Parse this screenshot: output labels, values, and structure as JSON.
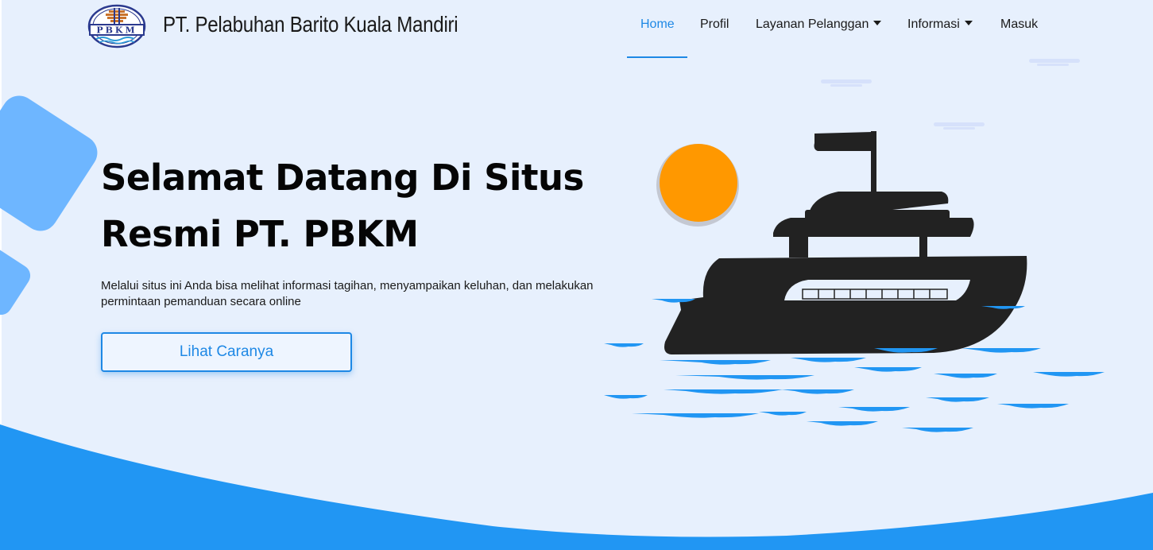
{
  "brand": {
    "name": "PT. Pelabuhan Barito Kuala Mandiri",
    "logo_text": "PBKM"
  },
  "nav": {
    "items": [
      {
        "label": "Home",
        "active": true,
        "dropdown": false
      },
      {
        "label": "Profil",
        "active": false,
        "dropdown": false
      },
      {
        "label": "Layanan Pelanggan",
        "active": false,
        "dropdown": true
      },
      {
        "label": "Informasi",
        "active": false,
        "dropdown": true
      },
      {
        "label": "Masuk",
        "active": false,
        "dropdown": false
      }
    ]
  },
  "hero": {
    "title_line1": "Selamat Datang Di Situs",
    "title_line2": "Resmi PT. PBKM",
    "description": "Melalui situs ini Anda bisa melihat informasi tagihan, menyampaikan keluhan, dan melakukan permintaan pemanduan secara online",
    "cta_label": "Lihat Caranya"
  },
  "colors": {
    "background": "#e7f0fd",
    "accent": "#1e88e5",
    "wave": "#2196f3",
    "sun": "#ff9800",
    "ship": "#222222",
    "deco": "#6eb6ff"
  },
  "icons": {
    "logo": "pbkm-logo-icon",
    "dropdown": "caret-down-icon",
    "illustration": "ship-illustration"
  }
}
